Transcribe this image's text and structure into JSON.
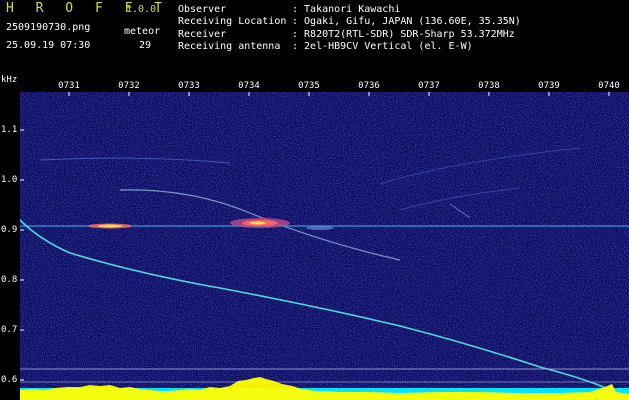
{
  "header": {
    "app_title": "H R O F F T",
    "version": "1.0.0",
    "file_name": "2509190730.png",
    "date_time": "25.09.19 07:30",
    "meteor_label": "meteor",
    "meteor_count": "29",
    "fields": [
      {
        "label": "Observer",
        "value": ": Takanori Kawachi"
      },
      {
        "label": "Receiving Location",
        "value": ": Ogaki, Gifu, JAPAN (136.60E, 35.35N)"
      },
      {
        "label": "Receiver",
        "value": ": R820T2(RTL-SDR) SDR-Sharp 53.372MHz"
      },
      {
        "label": "Receiving antenna",
        "value": ": 2el-HB9CV Vertical (el. E-W)"
      }
    ]
  },
  "axes": {
    "freq_unit": "kHz",
    "time_labels": [
      "0731",
      "0732",
      "0733",
      "0734",
      "0735",
      "0736",
      "0737",
      "0738",
      "0739",
      "0740"
    ],
    "freq_labels": [
      "1.1",
      "1.0",
      "0.9",
      "0.8",
      "0.7",
      "0.6"
    ]
  },
  "colors": {
    "background": "#000000",
    "spectrogram_bg": "#0a0a5c",
    "trace": "#4fd8d8",
    "level_yellow": "#ffff00",
    "level_cyan": "#00e5ff"
  }
}
